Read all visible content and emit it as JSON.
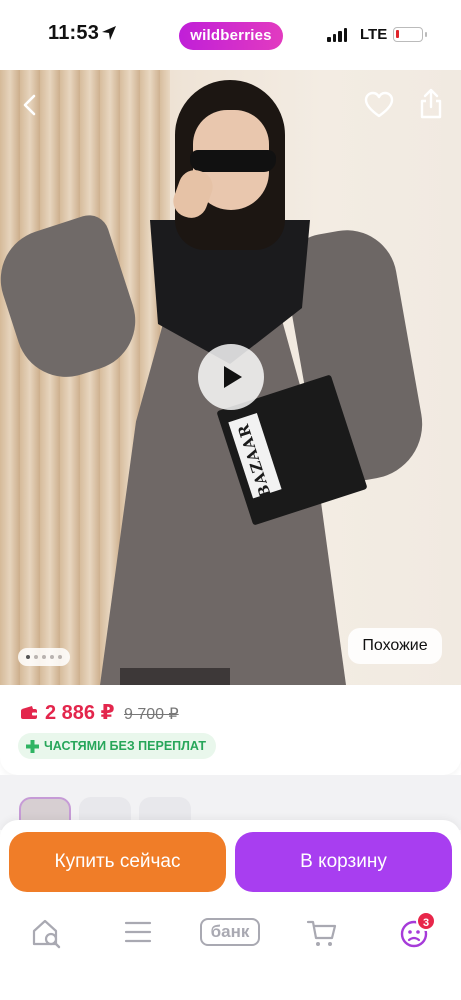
{
  "status_bar": {
    "time": "11:53",
    "brand": "wildberries",
    "network": "LTE",
    "battery_level": 0.1
  },
  "product": {
    "magazine_title": "BAZAAR",
    "similar_label": "Похожие",
    "gallery_total": 5,
    "gallery_current": 1,
    "thumbnails_visible": 3
  },
  "pricing": {
    "price": "2 886 ₽",
    "old_price": "9 700 ₽",
    "installments_label": "ЧАСТЯМИ БЕЗ ПЕРЕПЛАТ"
  },
  "actions": {
    "buy_now_label": "Купить сейчас",
    "add_to_cart_label": "В корзину"
  },
  "tab_bar": {
    "bank_label": "банк",
    "profile_badge": "3"
  },
  "colors": {
    "brand_gradient_start": "#c01fd8",
    "brand_gradient_end": "#e23bc0",
    "price_red": "#e3264c",
    "buy_now_orange": "#f07d28",
    "cart_purple": "#a83ef0",
    "installments_green": "#27a65a",
    "profile_purple": "#a63bd9"
  },
  "icons": {
    "back": "chevron-left-icon",
    "favorite": "heart-icon",
    "share": "share-icon",
    "play": "play-icon",
    "wallet": "wallet-icon",
    "installments": "plus-icon",
    "home": "home-search-icon",
    "catalog": "menu-icon",
    "cart": "cart-icon",
    "profile": "profile-icon"
  }
}
